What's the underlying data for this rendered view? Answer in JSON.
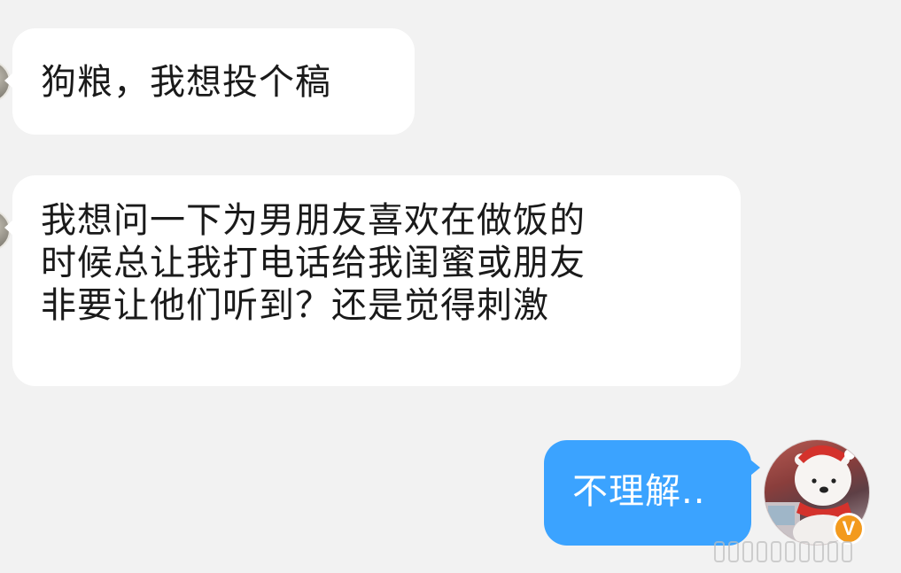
{
  "conversation": {
    "messages": [
      {
        "sender": "other",
        "lines": [
          "狗粮，我想投个稿"
        ]
      },
      {
        "sender": "other",
        "lines": [
          "我想问一下为男朋友喜欢在做饭的",
          "时候总让我打电话给我闺蜜或朋友",
          "非要让他们听到？还是觉得刺激"
        ]
      },
      {
        "sender": "self",
        "lines": [
          "不理解.."
        ]
      }
    ]
  },
  "self_avatar": {
    "icon": "polar-bear-avatar-icon",
    "badge_text": "V"
  },
  "other_avatar": {
    "icon": "user-avatar-icon"
  },
  "colors": {
    "background": "#f2f2f2",
    "incoming_bubble": "#ffffff",
    "outgoing_bubble": "#3ba3ff",
    "vip_badge": "#f39a1d"
  }
}
